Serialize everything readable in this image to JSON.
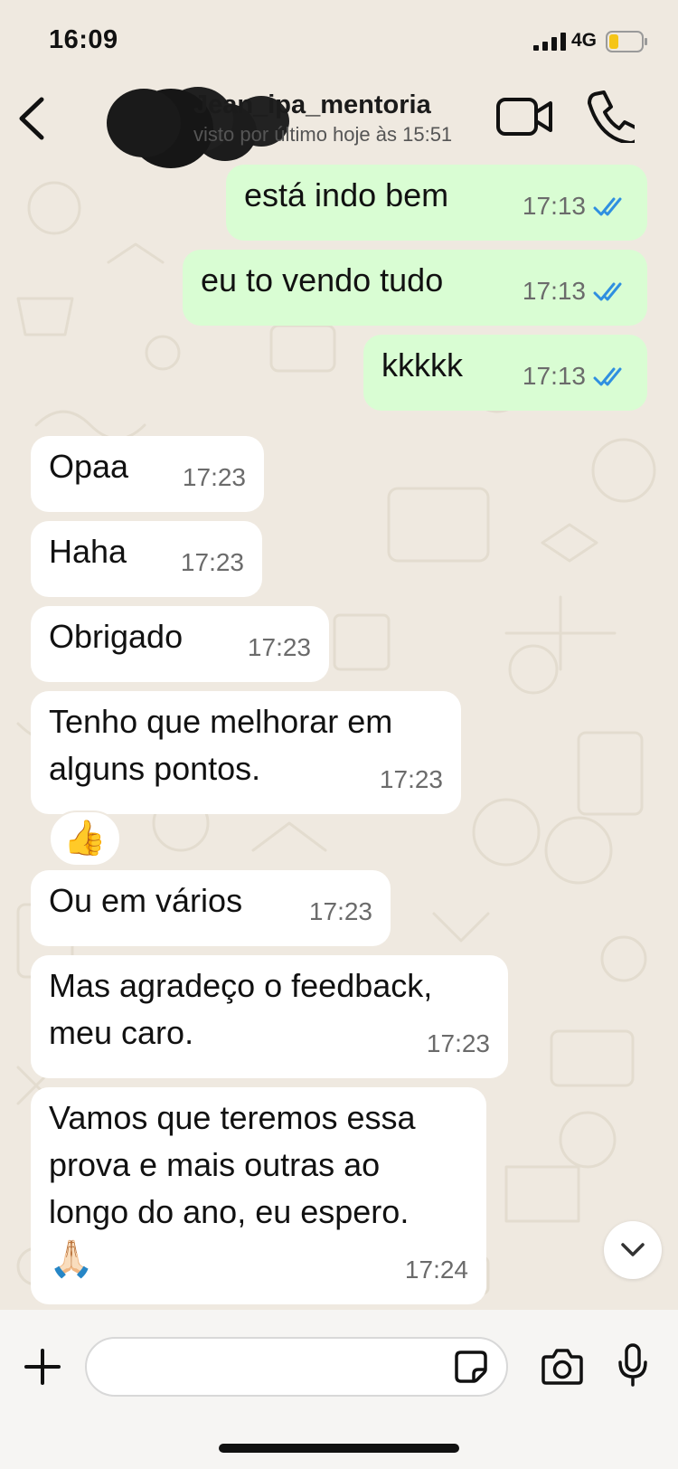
{
  "status_bar": {
    "time": "16:09",
    "network": "4G"
  },
  "header": {
    "contact_name": "Jean_ipa_mentoria",
    "last_seen": "visto por último hoje às 15:51"
  },
  "messages": [
    {
      "dir": "out",
      "text": "está indo bem",
      "time": "17:13",
      "read": true
    },
    {
      "dir": "out",
      "text": "eu to vendo tudo",
      "time": "17:13",
      "read": true
    },
    {
      "dir": "out",
      "text": "kkkkk",
      "time": "17:13",
      "read": true
    },
    {
      "dir": "in",
      "text": "Opaa",
      "time": "17:23"
    },
    {
      "dir": "in",
      "text": "Haha",
      "time": "17:23"
    },
    {
      "dir": "in",
      "text": "Obrigado",
      "time": "17:23"
    },
    {
      "dir": "in",
      "lines": [
        "Tenho que melhorar em",
        "alguns pontos."
      ],
      "time": "17:23"
    },
    {
      "dir": "in",
      "text": "Ou em vários",
      "time": "17:23"
    },
    {
      "dir": "in",
      "lines": [
        "Mas agradeço o feedback,",
        "meu caro."
      ],
      "time": "17:23"
    },
    {
      "dir": "in",
      "lines": [
        "Vamos que teremos essa",
        "prova e mais outras ao",
        "longo do ano, eu espero."
      ],
      "emoji": "🙏🏻",
      "time": "17:24"
    }
  ],
  "reaction": {
    "emoji": "👍"
  },
  "composer": {
    "placeholder": ""
  },
  "colors": {
    "outgoing_bubble": "#d9fdd3",
    "incoming_bubble": "#ffffff",
    "read_ticks": "#2f8fe0",
    "wallpaper": "#efe9e0"
  }
}
